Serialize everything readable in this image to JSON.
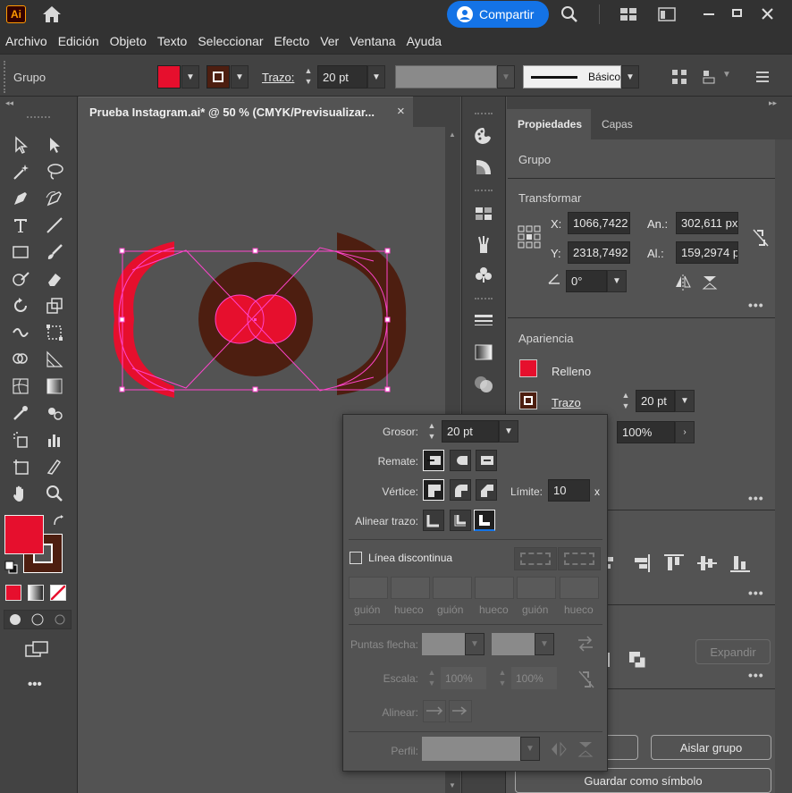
{
  "app": {
    "logo": "Ai",
    "share_label": "Compartir"
  },
  "menu": [
    "Archivo",
    "Edición",
    "Objeto",
    "Texto",
    "Seleccionar",
    "Efecto",
    "Ver",
    "Ventana",
    "Ayuda"
  ],
  "control_bar": {
    "selection_label": "Grupo",
    "stroke_link": "Trazo:",
    "stroke_value": "20 pt",
    "profile_label": "Básico",
    "fill_color": "#e60f2d",
    "stroke_color": "#4d1e10"
  },
  "document": {
    "tab_title": "Prueba Instagram.ai* @ 50 % (CMYK/Previsualizar...",
    "close": "×"
  },
  "properties": {
    "tabs": [
      "Propiedades",
      "Capas"
    ],
    "group_label": "Grupo",
    "transform_title": "Transformar",
    "x_label": "X:",
    "x_value": "1066,7422",
    "y_label": "Y:",
    "y_value": "2318,7492",
    "w_label": "An.:",
    "w_value": "302,611 px",
    "h_label": "Al.:",
    "h_value": "159,2974 p",
    "angle_value": "0°",
    "appearance_title": "Apariencia",
    "fill_label": "Relleno",
    "stroke_label": "Trazo",
    "stroke_value": "20 pt",
    "opacity_value": "100%",
    "expand_label": "Expandir",
    "ungroup_label": "Aislar grupo",
    "save_symbol_label": "Guardar como símbolo"
  },
  "stroke_panel": {
    "weight_label": "Grosor:",
    "weight_value": "20 pt",
    "cap_label": "Remate:",
    "corner_label": "Vértice:",
    "limit_label": "Límite:",
    "limit_value": "10",
    "limit_unit": "x",
    "align_label": "Alinear trazo:",
    "dashed_label": "Línea discontinua",
    "dash_labels": [
      "guión",
      "hueco",
      "guión",
      "hueco",
      "guión",
      "hueco"
    ],
    "arrowheads_label": "Puntas flecha:",
    "scale_label": "Escala:",
    "scale_1": "100%",
    "scale_2": "100%",
    "align_arrow_label": "Alinear:",
    "profile_label": "Perfil:"
  },
  "colors": {
    "fill": "#e60f2d",
    "stroke": "#4d1e10",
    "accent": "#1473e6",
    "selection": "#ff44cc"
  }
}
